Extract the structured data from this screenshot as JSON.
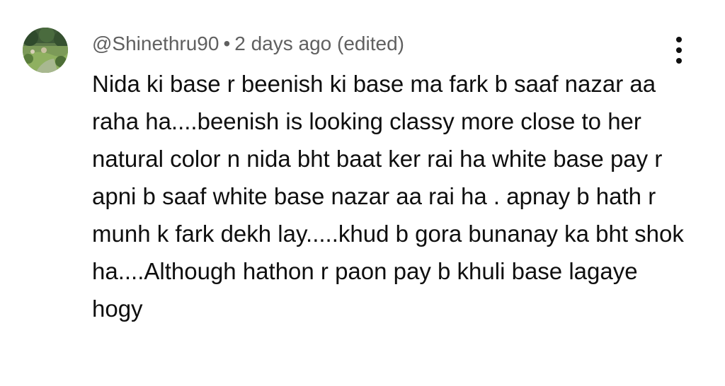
{
  "comment": {
    "author": "@Shinethru90",
    "separator": "•",
    "timestamp": "2 days ago (edited)",
    "text": "Nida ki base r beenish ki base ma fark b saaf nazar aa raha ha....beenish is looking classy more close to her natural color n nida bht baat ker rai ha white base pay r apni b saaf white base nazar aa rai ha . apnay b hath r munh k fark dekh lay.....khud b gora bunanay ka bht shok ha....Although hathon r paon pay b khuli base lagaye hogy"
  },
  "icons": {
    "avatar": "garden-landscape-avatar",
    "menu": "more-vertical-icon"
  },
  "colors": {
    "text_primary": "#0f0f0f",
    "text_secondary": "#606060",
    "background": "#ffffff"
  }
}
